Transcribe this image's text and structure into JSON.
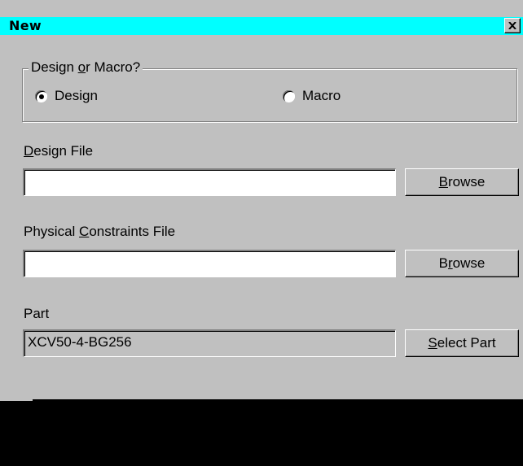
{
  "window": {
    "title": "New",
    "title_bar_color": "#00ffff",
    "close_icon": "close-x-icon"
  },
  "group": {
    "legend_pre": "Design ",
    "legend_u": "o",
    "legend_post": "r Macro?",
    "options": [
      {
        "label": "Design",
        "checked": true
      },
      {
        "label": "Macro",
        "checked": false
      }
    ]
  },
  "design_file": {
    "label_u": "D",
    "label_rest": "esign File",
    "value": "",
    "browse_u": "B",
    "browse_rest": "rowse"
  },
  "constraints_file": {
    "label_pre": "Physical ",
    "label_u": "C",
    "label_rest": "onstraints File",
    "value": "",
    "browse_pre": "B",
    "browse_u": "r",
    "browse_rest": "owse"
  },
  "part": {
    "label": "Part",
    "value": "XCV50-4-BG256",
    "select_u": "S",
    "select_rest": "elect Part"
  }
}
